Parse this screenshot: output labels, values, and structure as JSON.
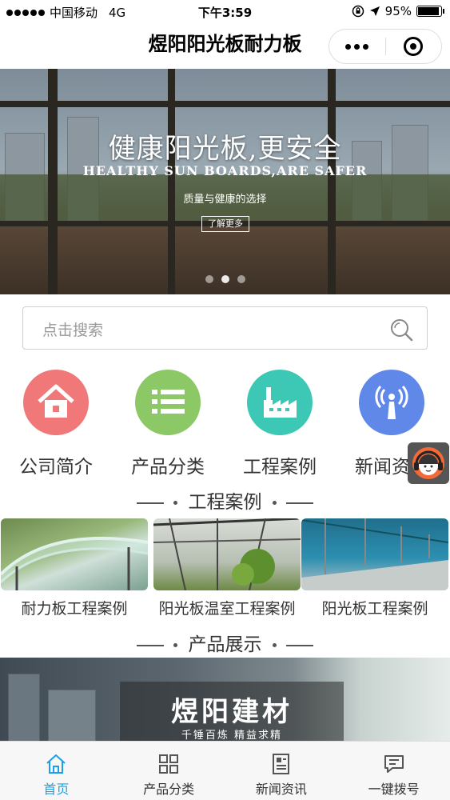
{
  "status_bar": {
    "carrier": "中国移动",
    "network": "4G",
    "time": "下午3:59",
    "battery_percent": 95,
    "battery_label": "95%"
  },
  "nav": {
    "title": "煜阳阳光板耐力板"
  },
  "banner": {
    "title": "健康阳光板,更安全",
    "subtitle_en": "HEALTHY SUN BOARDS,ARE SAFER",
    "tagline": "质量与健康的选择",
    "button_label": "了解更多",
    "slide_count": 3,
    "active_slide": 1
  },
  "search": {
    "placeholder": "点击搜索"
  },
  "quick_nav": [
    {
      "label": "公司简介",
      "icon": "home-icon",
      "color": "#f07878"
    },
    {
      "label": "产品分类",
      "icon": "list-icon",
      "color": "#8cc866"
    },
    {
      "label": "工程案例",
      "icon": "factory-icon",
      "color": "#3cc8b4"
    },
    {
      "label": "新闻资讯",
      "icon": "broadcast-icon",
      "color": "#5f88e8"
    }
  ],
  "sections": {
    "cases_title": "工程案例",
    "products_title": "产品展示"
  },
  "cases": [
    {
      "label": "耐力板工程案例"
    },
    {
      "label": "阳光板温室工程案例"
    },
    {
      "label": "阳光板工程案例"
    }
  ],
  "product": {
    "brand": "煜阳建材",
    "slogan": "千锤百炼 精益求精"
  },
  "tab_bar": [
    {
      "label": "首页",
      "icon": "home-outline-icon",
      "active": true
    },
    {
      "label": "产品分类",
      "icon": "grid-icon",
      "active": false
    },
    {
      "label": "新闻资讯",
      "icon": "news-icon",
      "active": false
    },
    {
      "label": "一键拨号",
      "icon": "chat-icon",
      "active": false
    }
  ],
  "colors": {
    "tab_active": "#1aa0e6",
    "float_button_bg": "#555555"
  }
}
